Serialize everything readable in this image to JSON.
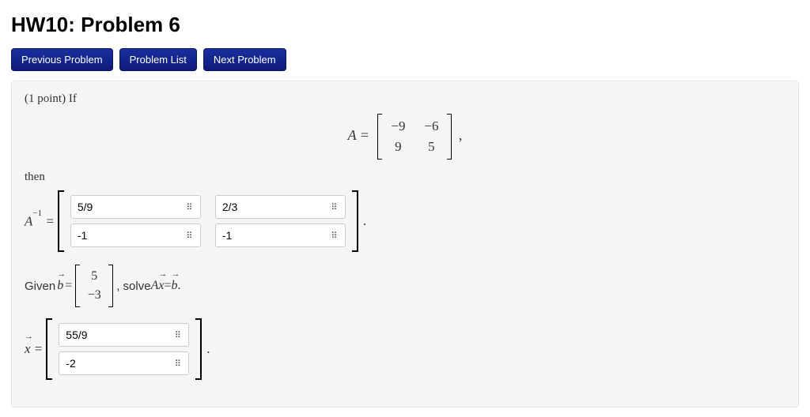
{
  "title": "HW10: Problem 6",
  "nav": {
    "prev": "Previous Problem",
    "list": "Problem List",
    "next": "Next Problem"
  },
  "problem": {
    "points_prefix": "(1 point) If",
    "matrixA": {
      "label": "A =",
      "rows": [
        [
          "−9",
          "−6"
        ],
        [
          "9",
          "5"
        ]
      ],
      "trail": ","
    },
    "then": "then",
    "A_inv": {
      "label_html": "A",
      "sup": "−1",
      "equals": " =",
      "cells": [
        [
          "5/9",
          "2/3"
        ],
        [
          "-1",
          "-1"
        ]
      ],
      "trail": "."
    },
    "given": {
      "prefix": "Given ",
      "b_label": "b",
      "equals": " = ",
      "b_rows": [
        [
          "5"
        ],
        [
          "−3"
        ]
      ],
      "solve_text": ", solve ",
      "eqn_A": "A",
      "eqn_x": "x",
      "eqn_eq": " = ",
      "eqn_b": "b",
      "trail": "."
    },
    "x_ans": {
      "label": "x",
      "equals": " =",
      "cells": [
        [
          "55/9"
        ],
        [
          "-2"
        ]
      ],
      "trail": "."
    }
  },
  "icons": {
    "keypad": "⠿"
  }
}
